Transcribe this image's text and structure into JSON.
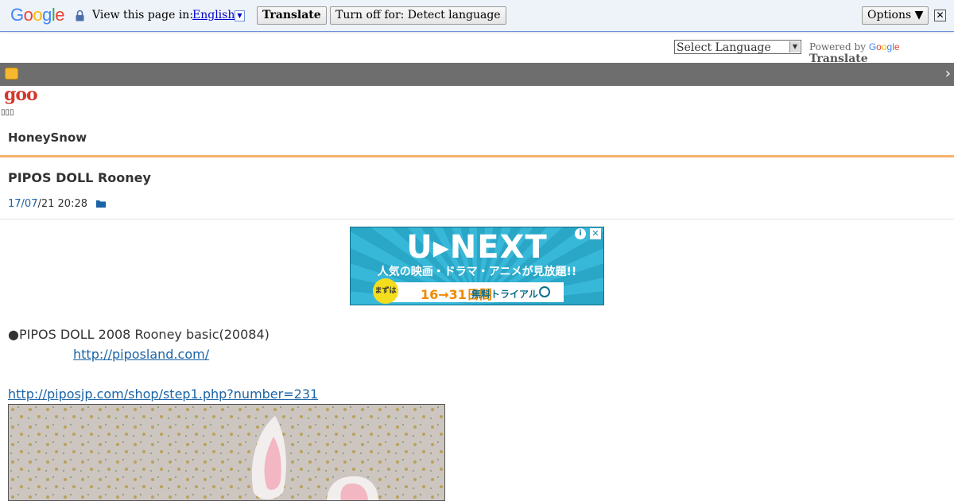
{
  "translate_bar": {
    "view_label": "View this page in:",
    "language": "English",
    "translate_button": "Translate",
    "turn_off_button": "Turn off for: Detect language",
    "options_button": "Options ▼"
  },
  "language_row": {
    "select_value": "Select Language",
    "powered_by": "Powered by",
    "google": "Google",
    "translate": "Translate"
  },
  "goo": {
    "logo": "goo",
    "tofu": "▯▯▯"
  },
  "blog": {
    "title": "HoneySnow"
  },
  "post": {
    "title": "PIPOS DOLL Rooney",
    "date_link": "17/07",
    "date_rest": "/21 20:28",
    "line1": "●PIPOS DOLL 2008 Rooney basic(20084)",
    "link1": "http://piposland.com/",
    "link2": "http://piposjp.com/shop/step1.php?number=231"
  },
  "ad": {
    "logo": "U▸NEXT",
    "tagline": "人気の映画・ドラマ・アニメが見放題!!",
    "badge": "まずは",
    "cta_main": "16→31日間",
    "cta_sub": "無料トライアル"
  }
}
